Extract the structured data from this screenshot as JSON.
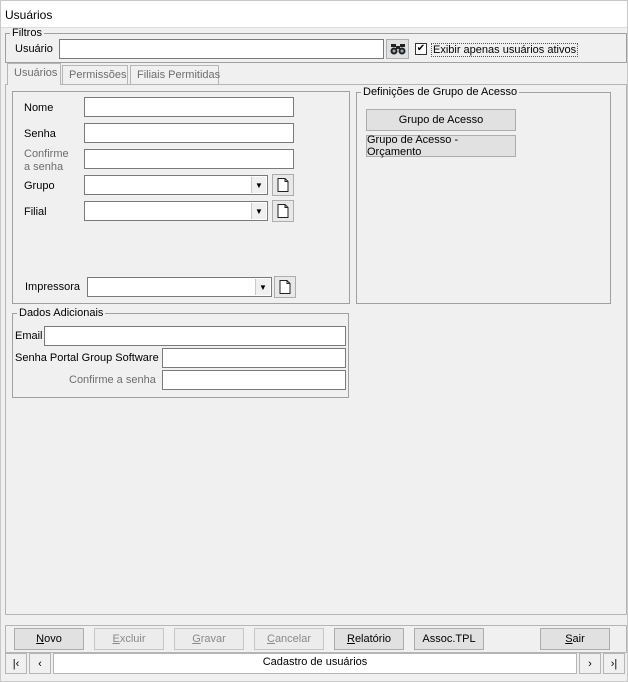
{
  "window": {
    "title": "Usuários"
  },
  "filters": {
    "legend": "Filtros",
    "user_label": "Usuário",
    "user_value": "",
    "search_icon": "binoculars-icon",
    "active_only_label": "Exibir apenas usuários ativos",
    "active_only_checked": true,
    "check_glyph": "✔"
  },
  "tabs": [
    {
      "label": "Usuários",
      "active": true
    },
    {
      "label": "Permissões",
      "active": false
    },
    {
      "label": "Filiais Permitidas",
      "active": false
    }
  ],
  "user_form": {
    "nome_label": "Nome",
    "senha_label": "Senha",
    "confirme_label_1": "Confirme",
    "confirme_label_2": "a senha",
    "grupo_label": "Grupo",
    "filial_label": "Filial",
    "impressora_label": "Impressora",
    "nome_value": "",
    "senha_value": "",
    "confirme_value": "",
    "dropdown_glyph": "▼"
  },
  "access_group": {
    "legend": "Definições de Grupo de Acesso",
    "btn_grupo": "Grupo de Acesso",
    "btn_orcamento": "Grupo de Acesso - Orçamento"
  },
  "extra": {
    "legend": "Dados Adicionais",
    "email_label": "Email",
    "portal_password_label": "Senha Portal Group Software",
    "portal_confirm_label": "Confirme a senha"
  },
  "actions": {
    "novo": {
      "pre": "",
      "u": "N",
      "post": "ovo"
    },
    "excluir": {
      "pre": "",
      "u": "E",
      "post": "xcluir"
    },
    "gravar": {
      "pre": "",
      "u": "G",
      "post": "ravar"
    },
    "cancelar": {
      "pre": "",
      "u": "C",
      "post": "ancelar"
    },
    "relatorio": {
      "pre": "",
      "u": "R",
      "post": "elatório"
    },
    "assoc": "Assoc.TPL",
    "sair": {
      "pre": "",
      "u": "S",
      "post": "air"
    }
  },
  "navigator": {
    "first": "|‹",
    "prev": "‹",
    "title": "Cadastro de usuários",
    "next": "›",
    "last": "›|"
  },
  "colors": {
    "background": "#f0f0f0",
    "border": "#a0a0a0",
    "disabled_text": "#8a8a8a"
  }
}
